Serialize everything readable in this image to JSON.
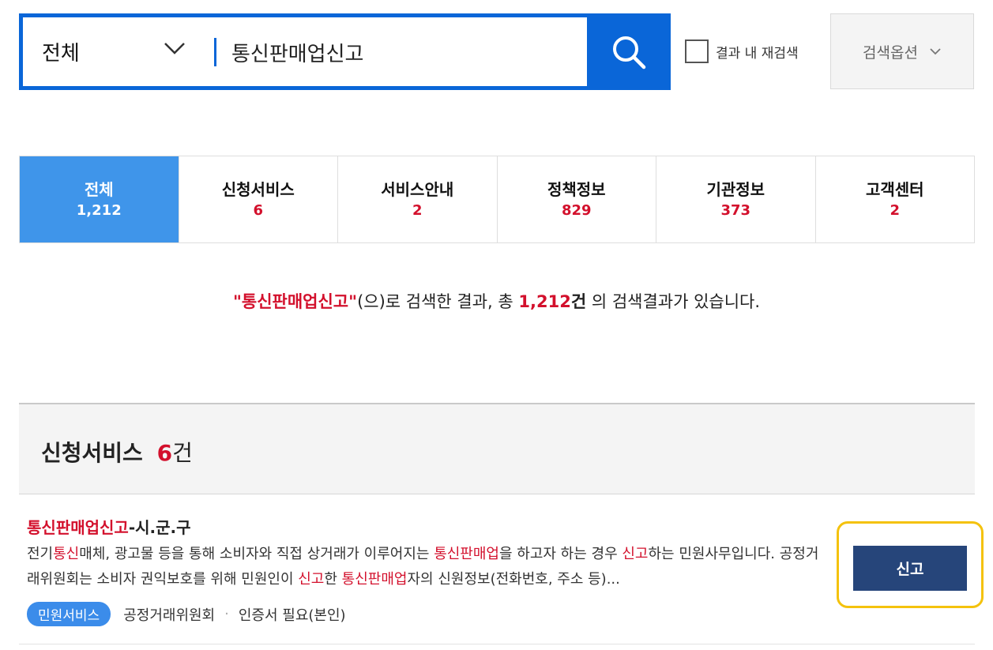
{
  "search": {
    "scope_label": "전체",
    "query": "통신판매업신고",
    "recheck_label": "결과 내 재검색",
    "options_label": "검색옵션"
  },
  "tabs": [
    {
      "name": "전체",
      "count": "1,212"
    },
    {
      "name": "신청서비스",
      "count": "6"
    },
    {
      "name": "서비스안내",
      "count": "2"
    },
    {
      "name": "정책정보",
      "count": "829"
    },
    {
      "name": "기관정보",
      "count": "373"
    },
    {
      "name": "고객센터",
      "count": "2"
    }
  ],
  "summary": {
    "keyword": "\"통신판매업신고\"",
    "text1": "(으)로 검색한 결과, 총 ",
    "total": "1,212",
    "unit": "건",
    "text2": " 의 검색결과가 있습니다."
  },
  "section": {
    "title": "신청서비스",
    "count": "6",
    "unit": "건"
  },
  "result": {
    "title_highlight": "통신판매업신고",
    "title_rest": "-시.군.구",
    "desc": {
      "p1": "전기",
      "h1": "통신",
      "p2": "매체, 광고물 등을 통해 소비자와 직접 상거래가 이루어지는 ",
      "h2": "통신판매업",
      "p3": "을 하고자 하는 경우 ",
      "h3": "신고",
      "p4": "하는 민원사무입니다. 공정거래위원회는 소비자 권익보호를 위해 민원인이 ",
      "h4": "신고",
      "p5": "한 ",
      "h5": "통신판매업",
      "p6": "자의 신원정보(전화번호, 주소 등)..."
    },
    "badge": "민원서비스",
    "agency": "공정거래위원회",
    "separator": "·",
    "cert": "인증서 필요(본인)",
    "button_label": "신고"
  },
  "colors": {
    "primary": "#0a66d8",
    "active_tab": "#3f95ea",
    "highlight": "#d3102c",
    "apply_button": "#26457a",
    "focus_frame": "#f4c20d"
  }
}
